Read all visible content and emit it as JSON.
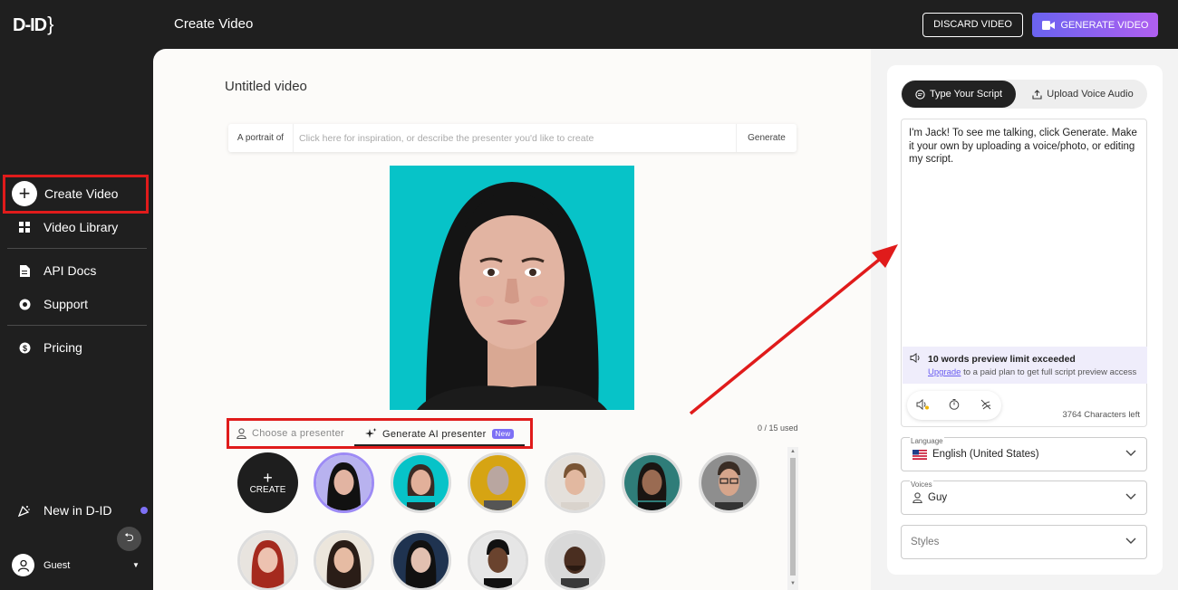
{
  "topbar": {
    "logo": "D-ID",
    "title": "Create Video",
    "discard_label": "DISCARD VIDEO",
    "generate_label": "GENERATE VIDEO"
  },
  "sidebar": {
    "items": [
      {
        "label": "Create Video",
        "icon": "plus-circle-icon"
      },
      {
        "label": "Video Library",
        "icon": "grid-icon"
      },
      {
        "label": "API Docs",
        "icon": "document-icon"
      },
      {
        "label": "Support",
        "icon": "lifebuoy-icon"
      },
      {
        "label": "Pricing",
        "icon": "dollar-icon"
      }
    ],
    "new_label": "New in D-ID",
    "user_label": "Guest"
  },
  "main": {
    "video_title": "Untitled video",
    "prompt_prefix": "A portrait of",
    "prompt_placeholder": "Click here for inspiration, or describe the presenter you'd like to create",
    "prompt_generate": "Generate",
    "tab_choose": "Choose a presenter",
    "tab_generate": "Generate AI presenter",
    "new_badge": "New",
    "used_count": "0 / 15 used",
    "create_label": "CREATE"
  },
  "right": {
    "tab_script": "Type Your Script",
    "tab_upload": "Upload Voice Audio",
    "script_text": "I'm Jack! To see me talking, click Generate. Make it your own by uploading a voice/photo, or editing my script.",
    "limit_title": "10 words preview limit exceeded",
    "limit_link": "Upgrade",
    "limit_rest": " to a paid plan to get full script preview access",
    "chars_left": "3764 Characters left",
    "language_label": "Language",
    "language_value": "English (United States)",
    "voices_label": "Voices",
    "voices_value": "Guy",
    "styles_placeholder": "Styles"
  },
  "colors": {
    "accent": "#7d70f5",
    "highlight": "#e01b1b",
    "portrait_bg": "#07c3c8"
  }
}
